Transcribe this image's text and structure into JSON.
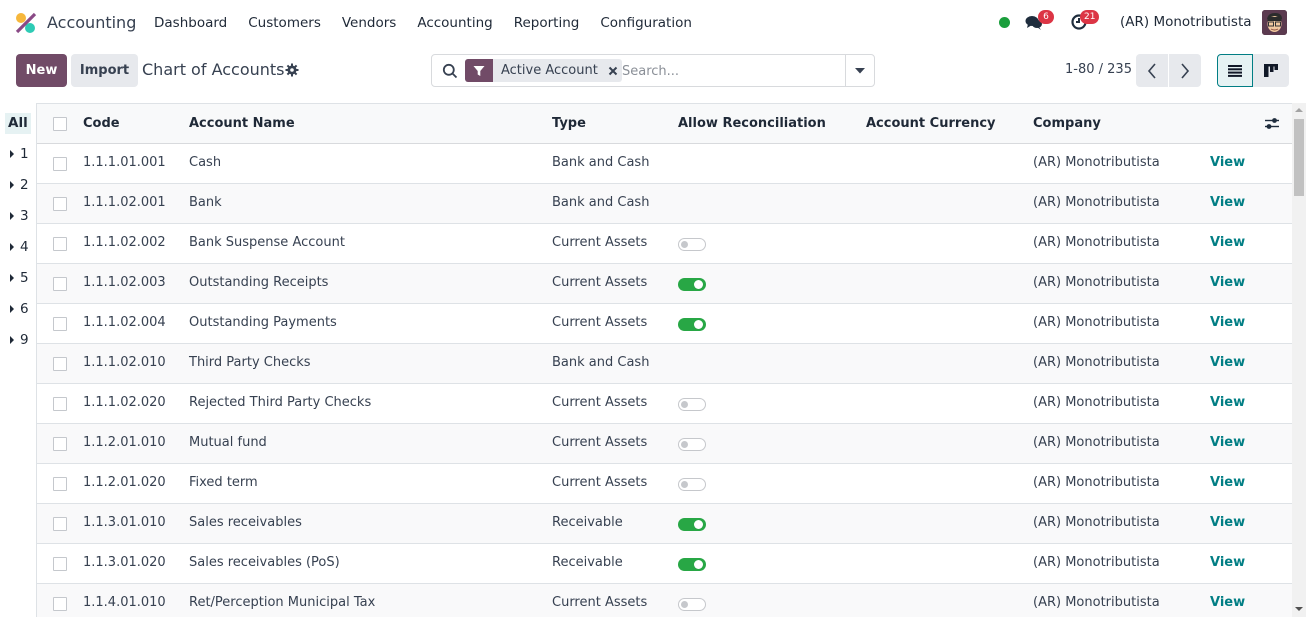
{
  "navbar": {
    "app_name": "Accounting",
    "menu": [
      "Dashboard",
      "Customers",
      "Vendors",
      "Accounting",
      "Reporting",
      "Configuration"
    ],
    "messages_count": "6",
    "activities_count": "21",
    "company": "(AR) Monotributista",
    "status_color": "#1a9e3c"
  },
  "control": {
    "new_label": "New",
    "import_label": "Import",
    "title": "Chart of Accounts",
    "search": {
      "facet_label": "Active Account",
      "placeholder": "Search...",
      "value": ""
    },
    "pager": "1-80 / 235"
  },
  "side_panel": {
    "all_label": "All",
    "groups": [
      "1",
      "2",
      "3",
      "4",
      "5",
      "6",
      "9"
    ]
  },
  "table": {
    "columns": [
      "Code",
      "Account Name",
      "Type",
      "Allow Reconciliation",
      "Account Currency",
      "Company"
    ],
    "view_label": "View",
    "rows": [
      {
        "code": "1.1.1.01.001",
        "name": "Cash",
        "type": "Bank and Cash",
        "reconcile": null,
        "currency": "",
        "company": "(AR) Monotributista"
      },
      {
        "code": "1.1.1.02.001",
        "name": "Bank",
        "type": "Bank and Cash",
        "reconcile": null,
        "currency": "",
        "company": "(AR) Monotributista"
      },
      {
        "code": "1.1.1.02.002",
        "name": "Bank Suspense Account",
        "type": "Current Assets",
        "reconcile": false,
        "currency": "",
        "company": "(AR) Monotributista"
      },
      {
        "code": "1.1.1.02.003",
        "name": "Outstanding Receipts",
        "type": "Current Assets",
        "reconcile": true,
        "currency": "",
        "company": "(AR) Monotributista"
      },
      {
        "code": "1.1.1.02.004",
        "name": "Outstanding Payments",
        "type": "Current Assets",
        "reconcile": true,
        "currency": "",
        "company": "(AR) Monotributista"
      },
      {
        "code": "1.1.1.02.010",
        "name": "Third Party Checks",
        "type": "Bank and Cash",
        "reconcile": null,
        "currency": "",
        "company": "(AR) Monotributista"
      },
      {
        "code": "1.1.1.02.020",
        "name": "Rejected Third Party Checks",
        "type": "Current Assets",
        "reconcile": false,
        "currency": "",
        "company": "(AR) Monotributista"
      },
      {
        "code": "1.1.2.01.010",
        "name": "Mutual fund",
        "type": "Current Assets",
        "reconcile": false,
        "currency": "",
        "company": "(AR) Monotributista"
      },
      {
        "code": "1.1.2.01.020",
        "name": "Fixed term",
        "type": "Current Assets",
        "reconcile": false,
        "currency": "",
        "company": "(AR) Monotributista"
      },
      {
        "code": "1.1.3.01.010",
        "name": "Sales receivables",
        "type": "Receivable",
        "reconcile": true,
        "currency": "",
        "company": "(AR) Monotributista"
      },
      {
        "code": "1.1.3.01.020",
        "name": "Sales receivables (PoS)",
        "type": "Receivable",
        "reconcile": true,
        "currency": "",
        "company": "(AR) Monotributista"
      },
      {
        "code": "1.1.4.01.010",
        "name": "Ret/Perception Municipal Tax",
        "type": "Current Assets",
        "reconcile": false,
        "currency": "",
        "company": "(AR) Monotributista"
      }
    ]
  },
  "icons": {
    "app_logo": "accounting-logo-icon",
    "messages": "chat-bubbles-icon",
    "activities": "clock-icon",
    "settings": "gear-icon",
    "search": "search-icon",
    "filter": "funnel-icon",
    "close": "close-icon",
    "dropdown": "caret-down-icon",
    "list_view": "list-icon",
    "kanban_view": "kanban-icon",
    "optional_columns": "sliders-icon"
  }
}
